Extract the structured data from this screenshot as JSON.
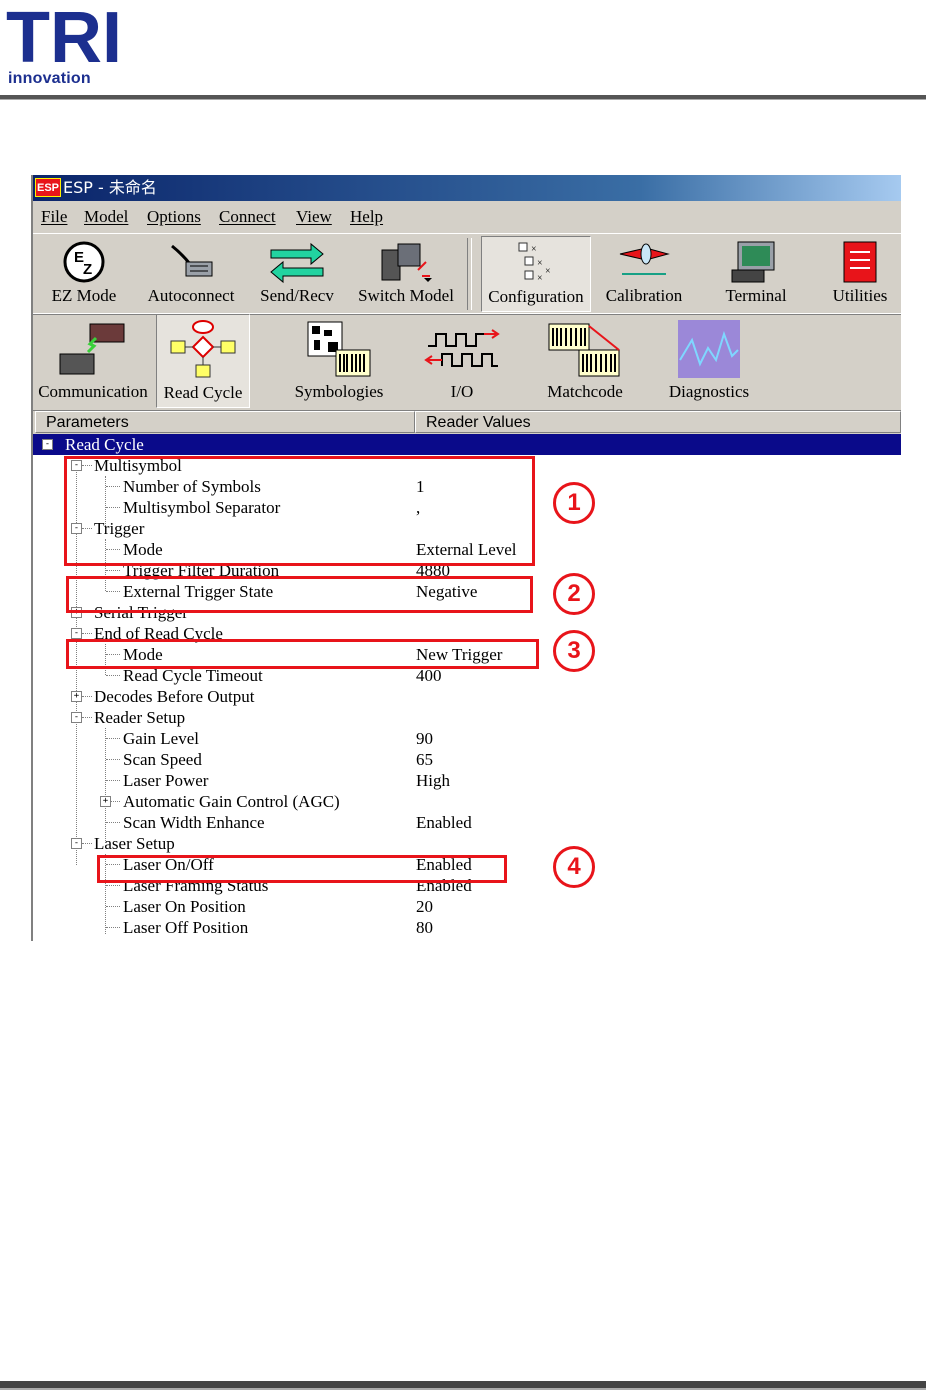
{
  "page": {
    "logo_letters": "TRI",
    "logo_subtitle": "innovation"
  },
  "window": {
    "title": "ESP - 未命名",
    "icon_label": "ESP"
  },
  "menu": [
    "File",
    "Model",
    "Options",
    "Connect",
    "View",
    "Help"
  ],
  "toolbar_main": [
    {
      "label": "EZ Mode",
      "icon": "ez-mode-icon"
    },
    {
      "label": "Autoconnect",
      "icon": "cable-icon"
    },
    {
      "label": "Send/Recv",
      "icon": "arrows-icon"
    },
    {
      "label": "Switch Model",
      "icon": "scanner-icon"
    },
    {
      "label": "Configuration",
      "icon": "tree-config-icon",
      "pressed": true
    },
    {
      "label": "Calibration",
      "icon": "laser-icon"
    },
    {
      "label": "Terminal",
      "icon": "terminal-icon"
    },
    {
      "label": "Utilities",
      "icon": "utilities-icon"
    }
  ],
  "toolbar_config": [
    {
      "label": "Communication",
      "icon": "communication-icon"
    },
    {
      "label": "Read Cycle",
      "icon": "flowchart-icon",
      "pressed": true
    },
    {
      "label": "Symbologies",
      "icon": "barcode-icon"
    },
    {
      "label": "I/O",
      "icon": "io-pulse-icon"
    },
    {
      "label": "Matchcode",
      "icon": "matchcode-icon"
    },
    {
      "label": "Diagnostics",
      "icon": "diagnostics-icon"
    }
  ],
  "grid": {
    "col_parameters": "Parameters",
    "col_values": "Reader Values"
  },
  "tree": [
    {
      "name": "Read Cycle",
      "value": "",
      "level": 0,
      "toggle": "-",
      "selected": true
    },
    {
      "name": "Multisymbol",
      "value": "",
      "level": 1,
      "toggle": "-"
    },
    {
      "name": "Number of Symbols",
      "value": "1",
      "level": 2
    },
    {
      "name": "Multisymbol Separator",
      "value": ",",
      "level": 2
    },
    {
      "name": "Trigger",
      "value": "",
      "level": 1,
      "toggle": "-"
    },
    {
      "name": "Mode",
      "value": "External Level",
      "level": 2
    },
    {
      "name": "Trigger Filter Duration",
      "value": "4880",
      "level": 2
    },
    {
      "name": "External Trigger State",
      "value": "Negative",
      "level": 2
    },
    {
      "name": "Serial Trigger",
      "value": "",
      "level": 1,
      "toggle": "+"
    },
    {
      "name": "End of Read Cycle",
      "value": "",
      "level": 1,
      "toggle": "-"
    },
    {
      "name": "Mode",
      "value": "New Trigger",
      "level": 2
    },
    {
      "name": "Read Cycle Timeout",
      "value": "400",
      "level": 2
    },
    {
      "name": "Decodes Before Output",
      "value": "",
      "level": 1,
      "toggle": "+"
    },
    {
      "name": "Reader Setup",
      "value": "",
      "level": 1,
      "toggle": "-"
    },
    {
      "name": "Gain Level",
      "value": "90",
      "level": 2
    },
    {
      "name": "Scan Speed",
      "value": "65",
      "level": 2
    },
    {
      "name": "Laser Power",
      "value": "High",
      "level": 2
    },
    {
      "name": "Automatic Gain Control (AGC)",
      "value": "",
      "level": 2,
      "toggle": "+"
    },
    {
      "name": "Scan Width Enhance",
      "value": "Enabled",
      "level": 2
    },
    {
      "name": "Laser Setup",
      "value": "",
      "level": 1,
      "toggle": "-"
    },
    {
      "name": "Laser On/Off",
      "value": "Enabled",
      "level": 2
    },
    {
      "name": "Laser Framing Status",
      "value": "Enabled",
      "level": 2
    },
    {
      "name": "Laser On Position",
      "value": "20",
      "level": 2
    },
    {
      "name": "Laser Off Position",
      "value": "80",
      "level": 2
    }
  ],
  "annotations": [
    "1",
    "2",
    "3",
    "4"
  ],
  "colors": {
    "highlight": "#e8141a",
    "selection": "#0a0a8a",
    "titlebar": "#0a246a",
    "logo": "#1c2f8f"
  }
}
